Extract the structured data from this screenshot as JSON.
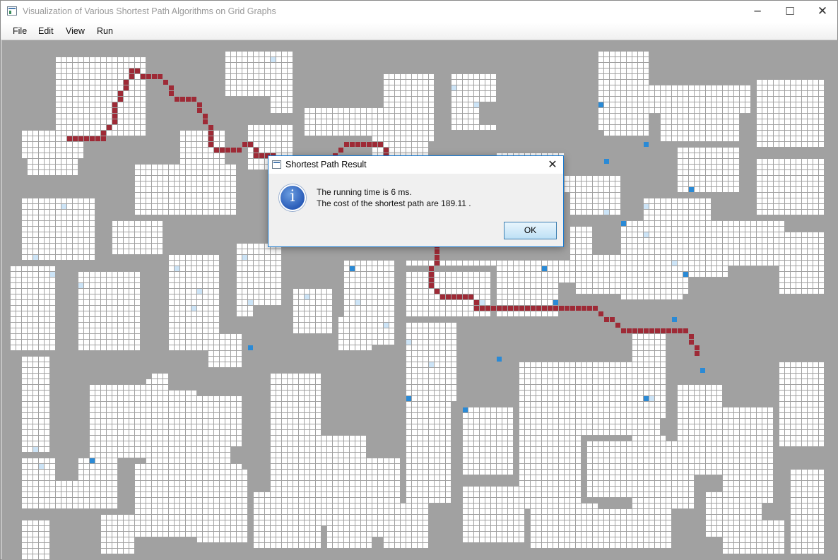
{
  "window": {
    "title": "Visualization of Various Shortest Path Algorithms on Grid Graphs",
    "minimize_glyph": "─",
    "maximize_glyph": "☐",
    "close_glyph": "✕"
  },
  "menu": {
    "items": [
      {
        "label": "File"
      },
      {
        "label": "Edit"
      },
      {
        "label": "View"
      },
      {
        "label": "Run"
      }
    ]
  },
  "grid": {
    "colors": {
      "background": "#a1a1a1",
      "cell": "#ffffff",
      "cell_border": "#a1a1a1",
      "path": "#9e2a36",
      "visited": "#cce4f7",
      "endpoint": "#2a8ad6"
    }
  },
  "dialog": {
    "title": "Shortest Path Result",
    "close_glyph": "✕",
    "icon_glyph": "i",
    "line1": "The running time is 6 ms.",
    "line2": "The cost of the shortest path are 189.11 .",
    "ok_label": "OK"
  }
}
